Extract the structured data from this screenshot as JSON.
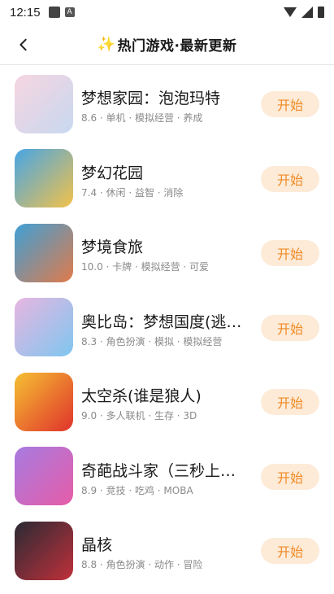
{
  "status": {
    "time": "12:15",
    "icon_a": "A"
  },
  "header": {
    "title_prefix": "✨",
    "title": "热门游戏·最新更新"
  },
  "games": [
    {
      "name": "梦想家园：泡泡玛特",
      "meta": "8.6 · 单机 · 模拟经营 · 养成",
      "button": "开始",
      "colors": [
        "#f6d5e0",
        "#c8d8f0"
      ]
    },
    {
      "name": "梦幻花园",
      "meta": "7.4 · 休闲 · 益智 · 消除",
      "button": "开始",
      "colors": [
        "#47a5e6",
        "#f2c24a"
      ]
    },
    {
      "name": "梦境食旅",
      "meta": "10.0 · 卡牌 · 模拟经营 · 可爱",
      "button": "开始",
      "colors": [
        "#3fa0d6",
        "#e07a4a"
      ]
    },
    {
      "name": "奥比岛：梦想国度(逃…",
      "meta": "8.3 · 角色扮演 · 模拟 · 模拟经营",
      "button": "开始",
      "colors": [
        "#e7b6e0",
        "#7fc6f0"
      ]
    },
    {
      "name": "太空杀(谁是狼人)",
      "meta": "9.0 · 多人联机 · 生存 · 3D",
      "button": "开始",
      "colors": [
        "#f5c033",
        "#e0322b"
      ]
    },
    {
      "name": "奇葩战斗家（三秒上手…",
      "meta": "8.9 · 竞技 · 吃鸡 · MOBA",
      "button": "开始",
      "colors": [
        "#a77be0",
        "#e65ca8"
      ]
    },
    {
      "name": "晶核",
      "meta": "8.8 · 角色扮演 · 动作 · 冒险",
      "button": "开始",
      "colors": [
        "#2a2a34",
        "#c0303a"
      ]
    }
  ]
}
